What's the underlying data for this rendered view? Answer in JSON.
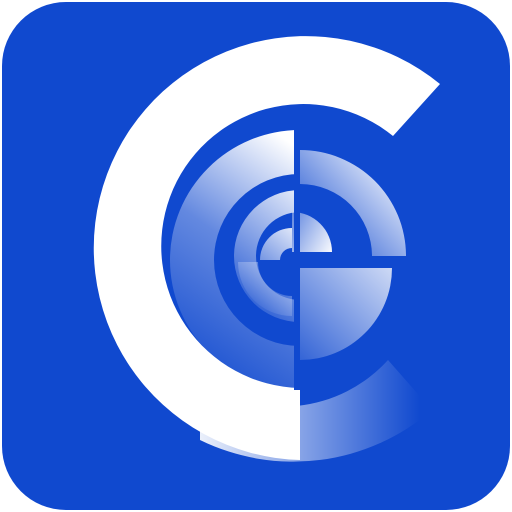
{
  "app_icon": {
    "icon": "concentric-c-g-logo-icon",
    "colors": {
      "background": "#1049CF",
      "foreground": "#FFFFFF"
    }
  }
}
